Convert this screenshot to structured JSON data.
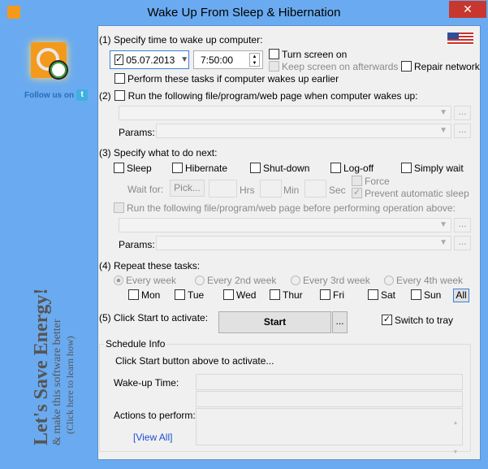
{
  "window": {
    "title": "Wake Up From Sleep & Hibernation",
    "close": "✕"
  },
  "sidebar": {
    "follow": "Follow us on",
    "twitter": "t",
    "promo_title": "Let's Save Energy!",
    "promo_sub": "& make this software better",
    "promo_link": "(Click here to learn how)"
  },
  "s1": {
    "label": "(1) Specify time to wake up computer:",
    "date": "05.07.2013",
    "time": "7:50:00",
    "turn_screen": "Turn screen on",
    "keep_screen": "Keep screen on afterwards",
    "repair": "Repair network",
    "perform_earlier": "Perform these tasks if computer wakes up earlier"
  },
  "s2": {
    "num": "(2)",
    "label": "Run the following file/program/web page when computer wakes up:",
    "params": "Params:",
    "dots": "..."
  },
  "s3": {
    "label": "(3) Specify what to do next:",
    "sleep": "Sleep",
    "hibernate": "Hibernate",
    "shutdown": "Shut-down",
    "logoff": "Log-off",
    "wait": "Simply wait",
    "wait_for": "Wait for:",
    "pick": "Pick...",
    "hrs": "Hrs",
    "min": "Min",
    "sec": "Sec",
    "force": "Force",
    "prevent": "Prevent automatic sleep",
    "run_before": "Run the following file/program/web page before performing operation above:",
    "params": "Params:",
    "dots": "..."
  },
  "s4": {
    "label": "(4) Repeat these tasks:",
    "every": [
      "Every week",
      "Every 2nd week",
      "Every 3rd week",
      "Every 4th week"
    ],
    "days": [
      "Mon",
      "Tue",
      "Wed",
      "Thur",
      "Fri",
      "Sat",
      "Sun"
    ],
    "all": "All"
  },
  "s5": {
    "label": "(5) Click Start to activate:",
    "start": "Start",
    "dots": "...",
    "tray": "Switch to tray"
  },
  "info": {
    "title": "Schedule Info",
    "hint": "Click Start button above to activate...",
    "wake_time": "Wake-up Time:",
    "actions": "Actions to perform:",
    "view_all": "[View All]"
  }
}
